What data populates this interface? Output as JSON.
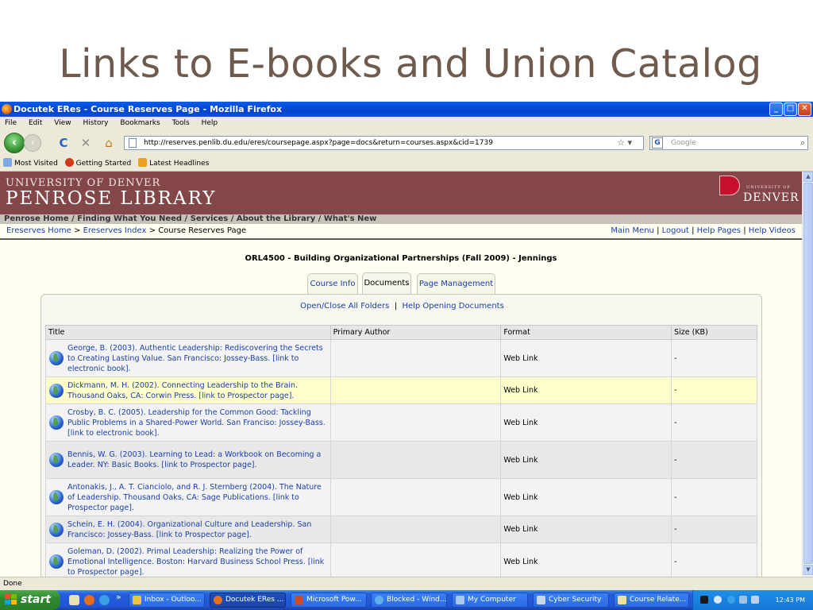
{
  "slide": {
    "title": "Links to E-books and Union Catalog"
  },
  "window": {
    "title": "Docutek ERes - Course Reserves Page - Mozilla Firefox",
    "controls": {
      "minimize": "_",
      "maximize": "□",
      "close": "✕"
    }
  },
  "menu": [
    "File",
    "Edit",
    "View",
    "History",
    "Bookmarks",
    "Tools",
    "Help"
  ],
  "navbar": {
    "back": "‹",
    "forward": "›",
    "reload": "C",
    "stop": "✕",
    "home": "⌂",
    "url": "http://reserves.penlib.du.edu/eres/coursepage.aspx?page=docs&return=courses.aspx&cid=1739",
    "search_placeholder": "Google",
    "search_logo": "G"
  },
  "bookmarks": [
    "Most Visited",
    "Getting Started",
    "Latest Headlines"
  ],
  "banner": {
    "university": "UNIVERSITY OF DENVER",
    "library": "PENROSE LIBRARY",
    "logo_small": "UNIVERSITY OF",
    "logo_big": "DENVER"
  },
  "library_nav": "Penrose Home / Finding What You Need / Services / About the Library / What's New",
  "ereserves_nav": {
    "home": "Ereserves Home",
    "sep1": ">",
    "index": "Ereserves Index",
    "sep2": ">",
    "current": "Course Reserves Page",
    "main_menu": "Main Menu",
    "logout": "Logout",
    "help_pages": "Help Pages",
    "help_videos": "Help Videos",
    "pipe": "|"
  },
  "course_title": "ORL4500 - Building Organizational Partnerships (Fall 2009) - Jennings",
  "tabs": [
    "Course Info",
    "Documents",
    "Page Management"
  ],
  "panel": {
    "open_close": "Open/Close All Folders",
    "sep": "|",
    "help_docs": "Help Opening Documents"
  },
  "table": {
    "headers": [
      "Title",
      "Primary Author",
      "Format",
      "Size (KB)"
    ],
    "rows": [
      {
        "title": "George, B. (2003). Authentic Leadership: Rediscovering the Secrets to Creating Lasting Value. San Francisco: Jossey-Bass. [link to electronic book].",
        "author": "",
        "format": "Web Link",
        "size": "-"
      },
      {
        "title": "Dickmann, M. H. (2002). Connecting Leadership to the Brain. Thousand Oaks, CA: Corwin Press. [link to Prospector page].",
        "author": "",
        "format": "Web Link",
        "size": "-"
      },
      {
        "title": "Crosby, B. C. (2005). Leadership for the Common Good: Tackling Public Problems in a Shared-Power World. San Franciso: Jossey-Bass. [link to electronic book].",
        "author": "",
        "format": "Web Link",
        "size": "-"
      },
      {
        "title": "Bennis, W. G. (2003). Learning to Lead: a Workbook on Becoming a Leader. NY: Basic Books. [link to Prospector page].",
        "author": "",
        "format": "Web Link",
        "size": "-"
      },
      {
        "title": "Antonakis, J., A. T. Cianciolo, and R. J. Sternberg (2004). The Nature of Leadership. Thousand Oaks, CA: Sage Publications. [link to Prospector page].",
        "author": "",
        "format": "Web Link",
        "size": "-"
      },
      {
        "title": "Schein, E. H. (2004). Organizational Culture and Leadership. San Francisco: Jossey-Bass. [link to Prospector page].",
        "author": "",
        "format": "Web Link",
        "size": "-"
      },
      {
        "title": "Goleman, D. (2002). Primal Leadership: Realizing the Power of Emotional Intelligence. Boston: Harvard Business School Press. [link to Prospector page].",
        "author": "",
        "format": "Web Link",
        "size": "-"
      }
    ]
  },
  "statusbar": "Done",
  "taskbar": {
    "start": "start",
    "more": "»",
    "tasks": [
      "Inbox - Outloo...",
      "Docutek ERes ...",
      "Microsoft Pow...",
      "Blocked - Wind...",
      "My Computer",
      "Cyber Security",
      "Course Relate..."
    ],
    "clock": "12:43 PM"
  },
  "colors": {
    "banner": "#83474a",
    "link": "#1a3ea8",
    "highlight_row": "#ffffcc",
    "title_text": "#6f5a4e"
  }
}
